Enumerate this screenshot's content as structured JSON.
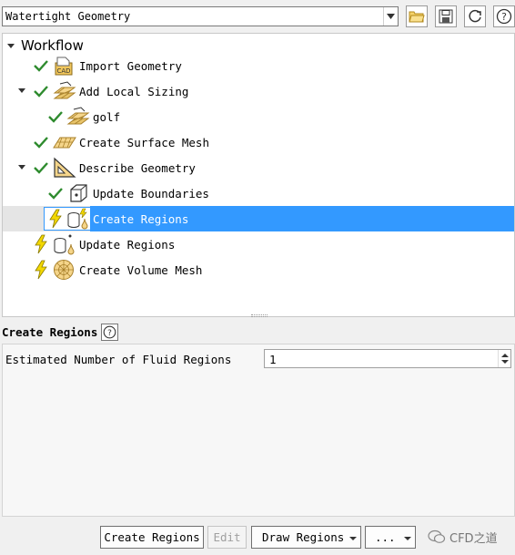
{
  "workflow_select": {
    "value": "Watertight Geometry"
  },
  "toolbar": {
    "icons": [
      "open-folder-icon",
      "save-icon",
      "refresh-icon",
      "help-icon"
    ]
  },
  "tree": {
    "root_label": "Workflow",
    "items": [
      {
        "label": "Import Geometry",
        "status": "done"
      },
      {
        "label": "Add Local Sizing",
        "status": "done",
        "expanded": true
      },
      {
        "label": "golf",
        "status": "done"
      },
      {
        "label": "Create Surface Mesh",
        "status": "done"
      },
      {
        "label": "Describe Geometry",
        "status": "done",
        "expanded": true
      },
      {
        "label": "Update Boundaries",
        "status": "done"
      },
      {
        "label": "Create Regions",
        "status": "pending",
        "selected": true
      },
      {
        "label": "Update Regions",
        "status": "pending"
      },
      {
        "label": "Create Volume Mesh",
        "status": "pending"
      }
    ]
  },
  "task": {
    "title": "Create Regions",
    "field_label": "Estimated Number of Fluid Regions",
    "field_value": "1"
  },
  "buttons": {
    "create": "Create Regions",
    "edit": "Edit",
    "draw": "Draw Regions",
    "more": "..."
  },
  "watermark": {
    "text": "CFD之道"
  },
  "colors": {
    "selection": "#3399ff",
    "check": "#2e8b2e",
    "lightning": "#f3d800"
  }
}
